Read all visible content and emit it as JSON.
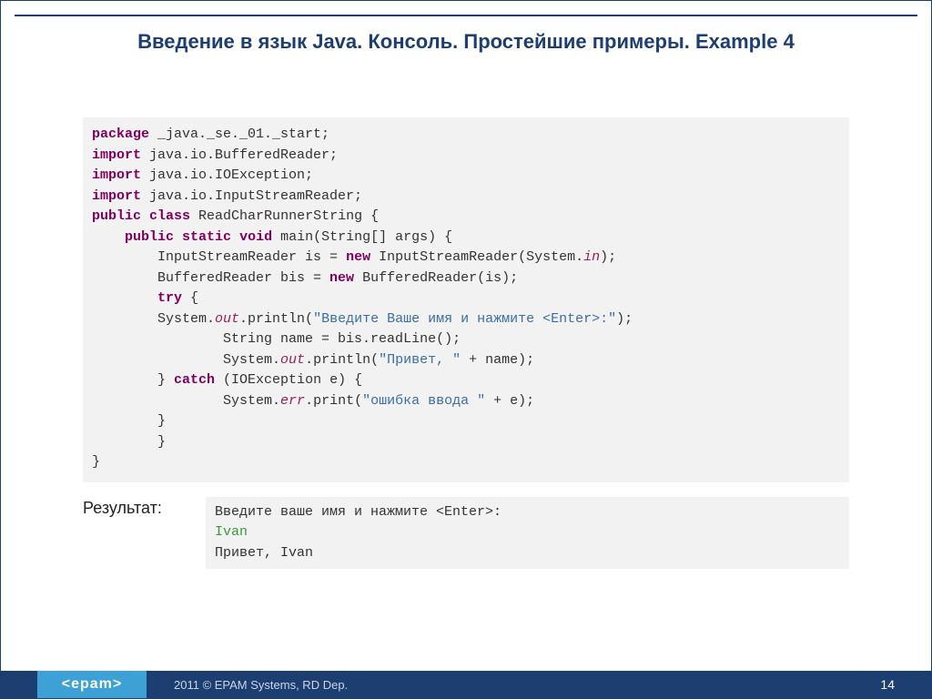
{
  "title": "Введение в язык Java. Консоль. Простейшие примеры. Example 4",
  "code": {
    "l1_kw": "package",
    "l1_rest": " _java._se._01._start;",
    "l2_kw": "import",
    "l2_rest": " java.io.BufferedReader;",
    "l3_kw": "import",
    "l3_rest": " java.io.IOException;",
    "l4_kw": "import",
    "l4_rest": " java.io.InputStreamReader;",
    "l5_kw1": "public",
    "l5_kw2": "class",
    "l5_rest": " ReadCharRunnerString {",
    "l6_pad": "    ",
    "l6_kw1": "public",
    "l6_kw2": "static",
    "l6_kw3": "void",
    "l6_rest": " main(String[] args) {",
    "l7_pad": "        ",
    "l7_a": "InputStreamReader is = ",
    "l7_kw": "new",
    "l7_b": " InputStreamReader(System.",
    "l7_fld": "in",
    "l7_c": ");",
    "l8_pad": "        ",
    "l8_a": "BufferedReader bis = ",
    "l8_kw": "new",
    "l8_b": " BufferedReader(is);",
    "l9_pad": "        ",
    "l9_kw": "try",
    "l9_rest": " {",
    "l10_pad": "        ",
    "l10_a": "System.",
    "l10_fld": "out",
    "l10_b": ".println(",
    "l10_str": "\"Введите Ваше имя и нажмите <Enter>:\"",
    "l10_c": ");",
    "l11_pad": "                ",
    "l11_rest": "String name = bis.readLine();",
    "l12_pad": "                ",
    "l12_a": "System.",
    "l12_fld": "out",
    "l12_b": ".println(",
    "l12_str": "\"Привет, \"",
    "l12_c": " + name);",
    "l13_pad": "        ",
    "l13_a": "} ",
    "l13_kw": "catch",
    "l13_b": " (IOException e) {",
    "l14_pad": "                ",
    "l14_a": "System.",
    "l14_fld": "err",
    "l14_b": ".print(",
    "l14_str": "\"ошибка ввода \"",
    "l14_c": " + e);",
    "l15": "        }",
    "l16": "        }",
    "l17": "}"
  },
  "result_label": "Результат:",
  "result": {
    "line1": "Введите ваше имя и нажмите <Enter>:",
    "line2": "Ivan",
    "line3": "Привет, Ivan"
  },
  "footer": {
    "logo": "<epam>",
    "copy": "2011 © EPAM Systems, RD Dep.",
    "page": "14"
  }
}
